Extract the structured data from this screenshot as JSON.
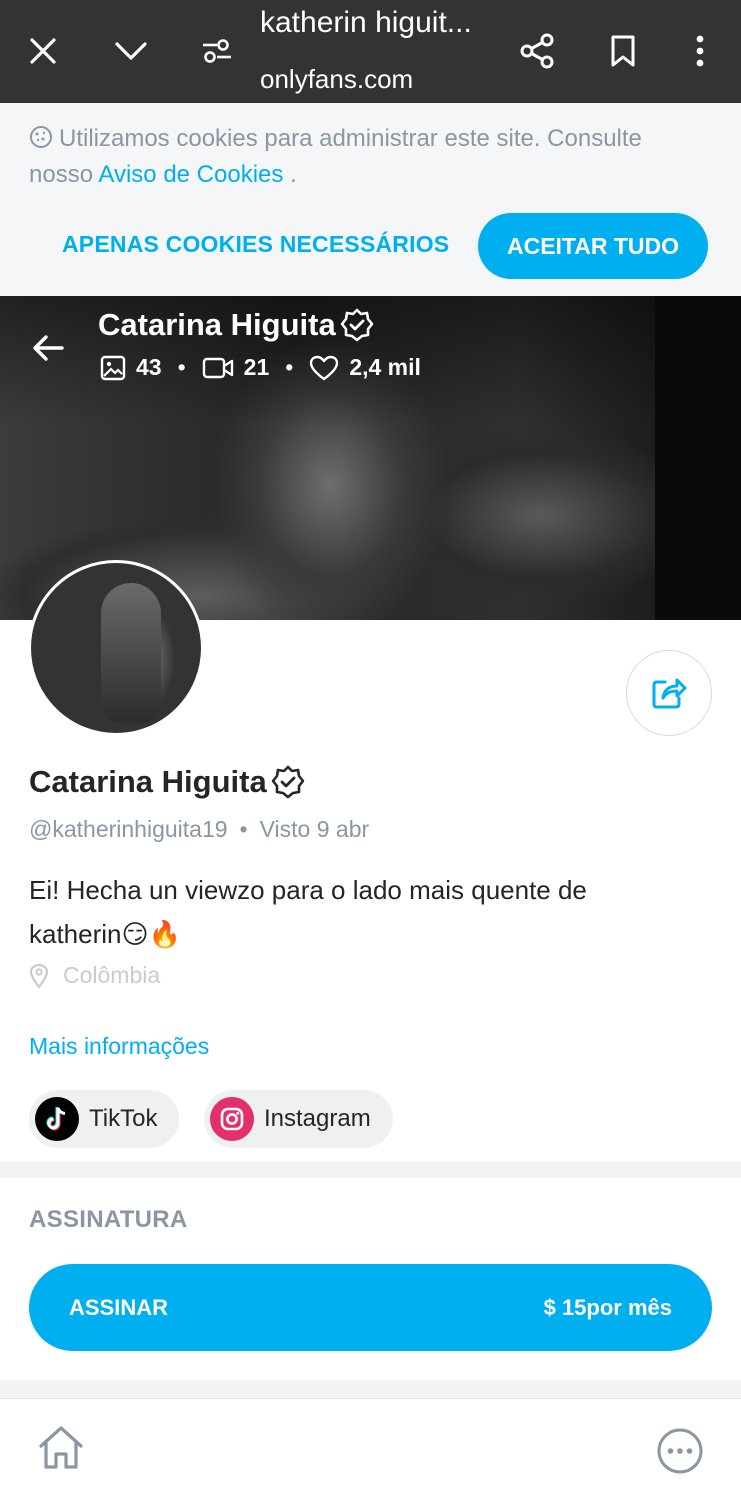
{
  "browser": {
    "title": "katherin higuit...",
    "url": "onlyfans.com"
  },
  "cookie_banner": {
    "text_before": "Utilizamos cookies para administrar este site. Consulte nosso ",
    "link_text": "Aviso de Cookies",
    "text_after": " .",
    "necessary_label": "APENAS COOKIES NECESSÁRIOS",
    "accept_label": "ACEITAR TUDO"
  },
  "cover": {
    "name": "Catarina Higuita",
    "photos_count": "43",
    "videos_count": "21",
    "likes_count": "2,4 mil",
    "separator": "•"
  },
  "profile": {
    "name": "Catarina Higuita",
    "handle": "@katherinhiguita19",
    "separator": "•",
    "seen_label": "Visto  9 abr",
    "bio_line1": "Ei! Hecha un viewzo para o lado mais quente de",
    "bio_line2": "katherin😏🔥",
    "location": "Colômbia",
    "more_info": "Mais informações"
  },
  "social": {
    "tiktok": "TikTok",
    "instagram": "Instagram"
  },
  "subscription": {
    "section_title": "ASSINATURA",
    "subscribe_label": "ASSINAR",
    "price_label": "$ 15por mês"
  },
  "colors": {
    "brand": "#00aff0",
    "browser_bar": "#333335",
    "muted_text": "#8a96a3"
  },
  "icons": {
    "browser": [
      "close-icon",
      "chevron-down-icon",
      "page-settings-icon",
      "share-icon",
      "bookmark-icon",
      "more-vertical-icon"
    ],
    "cover": [
      "back-arrow-icon",
      "verified-icon",
      "image-icon",
      "video-icon",
      "heart-icon"
    ],
    "nav": [
      "home-icon",
      "more-horizontal-icon"
    ]
  }
}
